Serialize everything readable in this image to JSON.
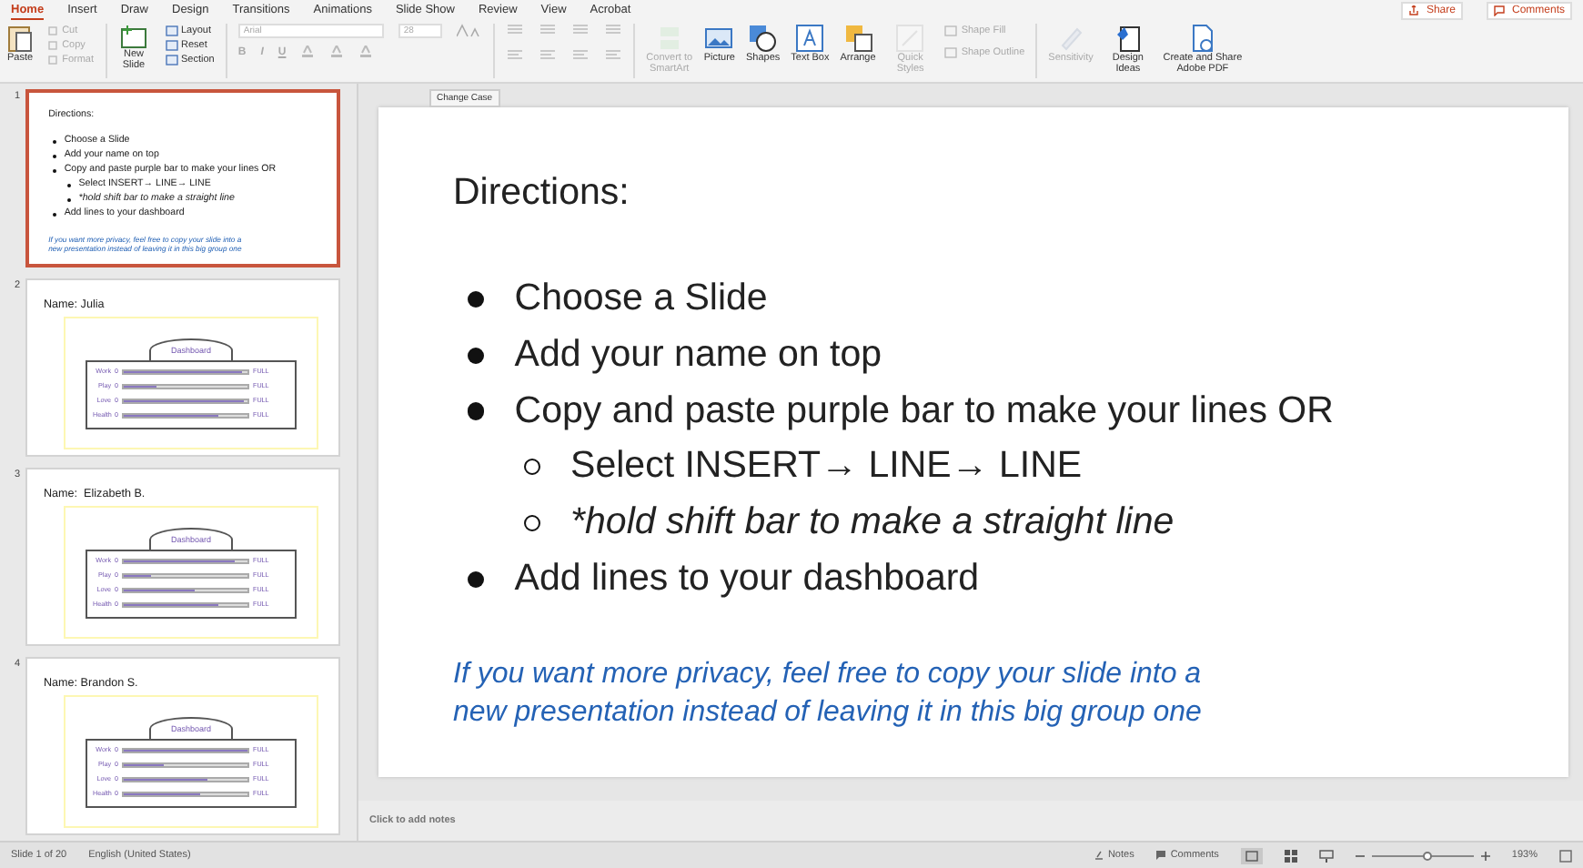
{
  "ribbon_tabs": [
    {
      "label": "Home",
      "selected": true
    },
    {
      "label": "Insert",
      "selected": false
    },
    {
      "label": "Draw",
      "selected": false
    },
    {
      "label": "Design",
      "selected": false
    },
    {
      "label": "Transitions",
      "selected": false
    },
    {
      "label": "Animations",
      "selected": false
    },
    {
      "label": "Slide Show",
      "selected": false
    },
    {
      "label": "Review",
      "selected": false
    },
    {
      "label": "View",
      "selected": false
    },
    {
      "label": "Acrobat",
      "selected": false
    }
  ],
  "header_buttons": [
    {
      "label": "Share",
      "kind": "share"
    },
    {
      "label": "Comments",
      "kind": "comments"
    }
  ],
  "clipboard": {
    "paste": "Paste",
    "small": [
      {
        "label": "Cut",
        "disabled": true
      },
      {
        "label": "Copy",
        "disabled": true
      },
      {
        "label": "Format",
        "disabled": true
      }
    ]
  },
  "slides_group": {
    "new_slide": "New Slide",
    "small": [
      {
        "label": "Layout"
      },
      {
        "label": "Reset"
      },
      {
        "label": "Section"
      }
    ]
  },
  "font": {
    "name": "Arial",
    "size": "28",
    "format_letters": [
      "B",
      "I",
      "U"
    ]
  },
  "ribbon_buttons": [
    {
      "label": "Convert to SmartArt",
      "kind": "smartart",
      "disabled": true
    },
    {
      "label": "Picture",
      "kind": "picture",
      "disabled": false
    },
    {
      "label": "Shapes",
      "kind": "shapes",
      "disabled": false
    },
    {
      "label": "Text Box",
      "kind": "textbox",
      "disabled": false
    },
    {
      "label": "Arrange",
      "kind": "arrange",
      "disabled": false
    },
    {
      "label": "Quick Styles",
      "kind": "styles",
      "disabled": true
    }
  ],
  "shape_options": [
    {
      "label": "Shape Fill",
      "disabled": true
    },
    {
      "label": "Shape Outline",
      "disabled": true
    }
  ],
  "ribbon_buttons_2": [
    {
      "label": "Sensitivity",
      "kind": "sensitivity",
      "disabled": true
    },
    {
      "label": "Design Ideas",
      "kind": "ideas",
      "disabled": false
    },
    {
      "label": "Create and Share Adobe PDF",
      "kind": "pdf",
      "disabled": false
    }
  ],
  "tooltip": "Change Case",
  "thumbnails": [
    {
      "number": "1",
      "selected": true,
      "kind": "directions",
      "title": "Directions:",
      "bullets": [
        {
          "text": "Choose a Slide"
        },
        {
          "text": "Add your name on top"
        },
        {
          "text": "Copy and paste purple bar to make your lines OR",
          "children": [
            {
              "text": "Select INSERT→ LINE→ LINE",
              "kind": "plain"
            },
            {
              "text": "*hold shift bar to make a straight line",
              "kind": "italic"
            }
          ]
        },
        {
          "text": "Add lines to your dashboard"
        }
      ],
      "note": "If you want more privacy, feel free to copy your slide into a new presentation instead of leaving it in this big group one"
    },
    {
      "number": "2",
      "selected": false,
      "kind": "dashboard",
      "name": "Name: Julia",
      "dashboard_title": "Dashboard",
      "rows": [
        {
          "label": "Work",
          "zero": "0",
          "level": 0.95,
          "end": "FULL"
        },
        {
          "label": "Play",
          "zero": "0",
          "level": 0.27,
          "end": "FULL"
        },
        {
          "label": "Love",
          "zero": "0",
          "level": 0.97,
          "end": "FULL"
        },
        {
          "label": "Health",
          "zero": "0",
          "level": 0.77,
          "end": "FULL"
        }
      ]
    },
    {
      "number": "3",
      "selected": false,
      "kind": "dashboard",
      "name": "Name:  Elizabeth B.",
      "dashboard_title": "Dashboard",
      "rows": [
        {
          "label": "Work",
          "zero": "0",
          "level": 0.9,
          "end": "FULL"
        },
        {
          "label": "Play",
          "zero": "0",
          "level": 0.22,
          "end": "FULL"
        },
        {
          "label": "Love",
          "zero": "0",
          "level": 0.57,
          "end": "FULL"
        },
        {
          "label": "Health",
          "zero": "0",
          "level": 0.77,
          "end": "FULL"
        }
      ]
    },
    {
      "number": "4",
      "selected": false,
      "kind": "dashboard",
      "name": "Name: Brandon S.",
      "dashboard_title": "Dashboard",
      "rows": [
        {
          "label": "Work",
          "zero": "0",
          "level": 1.0,
          "end": "FULL"
        },
        {
          "label": "Play",
          "zero": "0",
          "level": 0.33,
          "end": "FULL"
        },
        {
          "label": "Love",
          "zero": "0",
          "level": 0.67,
          "end": "FULL"
        },
        {
          "label": "Health",
          "zero": "0",
          "level": 0.62,
          "end": "FULL"
        }
      ]
    }
  ],
  "slide": {
    "title": "Directions:",
    "bullets": [
      {
        "text": "Choose a Slide"
      },
      {
        "text": "Add your name on top"
      },
      {
        "text": "Copy and paste purple bar to make your lines OR",
        "children": [
          {
            "text": "Select INSERT→ LINE→ LINE",
            "kind": "plain"
          },
          {
            "text": "*hold shift bar to make a straight line",
            "kind": "italic"
          }
        ]
      },
      {
        "text": "Add lines to your dashboard"
      }
    ],
    "note": "If you want more privacy, feel free to copy your slide into a new presentation instead of leaving it in this big group one"
  },
  "notes": {
    "placeholder": "Click to add notes"
  },
  "status_bar": {
    "slide_count": "Slide 1 of 20",
    "language": "English (United States)",
    "notes": "Notes",
    "comments": "Comments",
    "zoom": {
      "level": 0.55
    },
    "zoom_text": "193%"
  }
}
